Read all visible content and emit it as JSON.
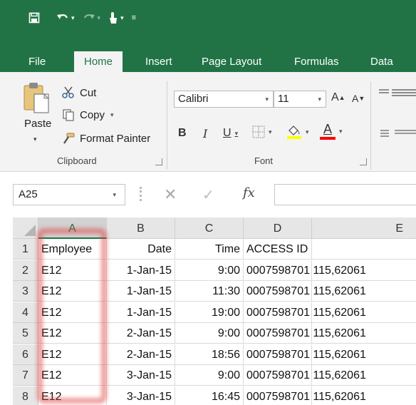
{
  "ribbon": {
    "tabs": [
      {
        "label": "File"
      },
      {
        "label": "Home"
      },
      {
        "label": "Insert"
      },
      {
        "label": "Page Layout"
      },
      {
        "label": "Formulas"
      },
      {
        "label": "Data"
      }
    ],
    "active_tab": "Home",
    "clipboard": {
      "paste_label": "Paste",
      "cut_label": "Cut",
      "copy_label": "Copy",
      "format_painter_label": "Format Painter",
      "group_label": "Clipboard"
    },
    "font": {
      "font_name": "Calibri",
      "font_size": "11",
      "bold_label": "B",
      "italic_label": "I",
      "underline_label": "U",
      "grow_label": "A",
      "shrink_label": "A",
      "font_color_label": "A",
      "group_label": "Font",
      "highlight_color": "#FFFF00",
      "font_color": "#FF0000"
    }
  },
  "formula_bar": {
    "name_box": "A25",
    "fx_label": "fx",
    "content": ""
  },
  "grid": {
    "columns": [
      "A",
      "B",
      "C",
      "D",
      "E"
    ],
    "selected_column": "A",
    "rows": [
      {
        "num": "1",
        "A": "Employee",
        "B": "Date",
        "C": "Time",
        "D": "ACCESS ID",
        "E": ""
      },
      {
        "num": "2",
        "A": "E12",
        "B": "1-Jan-15",
        "C": "9:00",
        "D": "0007598701 115,62061",
        "E": ""
      },
      {
        "num": "3",
        "A": "E12",
        "B": "1-Jan-15",
        "C": "11:30",
        "D": "0007598701 115,62061",
        "E": ""
      },
      {
        "num": "4",
        "A": "E12",
        "B": "1-Jan-15",
        "C": "19:00",
        "D": "0007598701 115,62061",
        "E": ""
      },
      {
        "num": "5",
        "A": "E12",
        "B": "2-Jan-15",
        "C": "9:00",
        "D": "0007598701 115,62061",
        "E": ""
      },
      {
        "num": "6",
        "A": "E12",
        "B": "2-Jan-15",
        "C": "18:56",
        "D": "0007598701 115,62061",
        "E": ""
      },
      {
        "num": "7",
        "A": "E12",
        "B": "3-Jan-15",
        "C": "9:00",
        "D": "0007598701 115,62061",
        "E": ""
      },
      {
        "num": "8",
        "A": "E12",
        "B": "3-Jan-15",
        "C": "16:45",
        "D": "0007598701 115,62061",
        "E": ""
      }
    ],
    "annotation_color": "#E03C3C"
  },
  "theme": {
    "accent": "#217346"
  }
}
